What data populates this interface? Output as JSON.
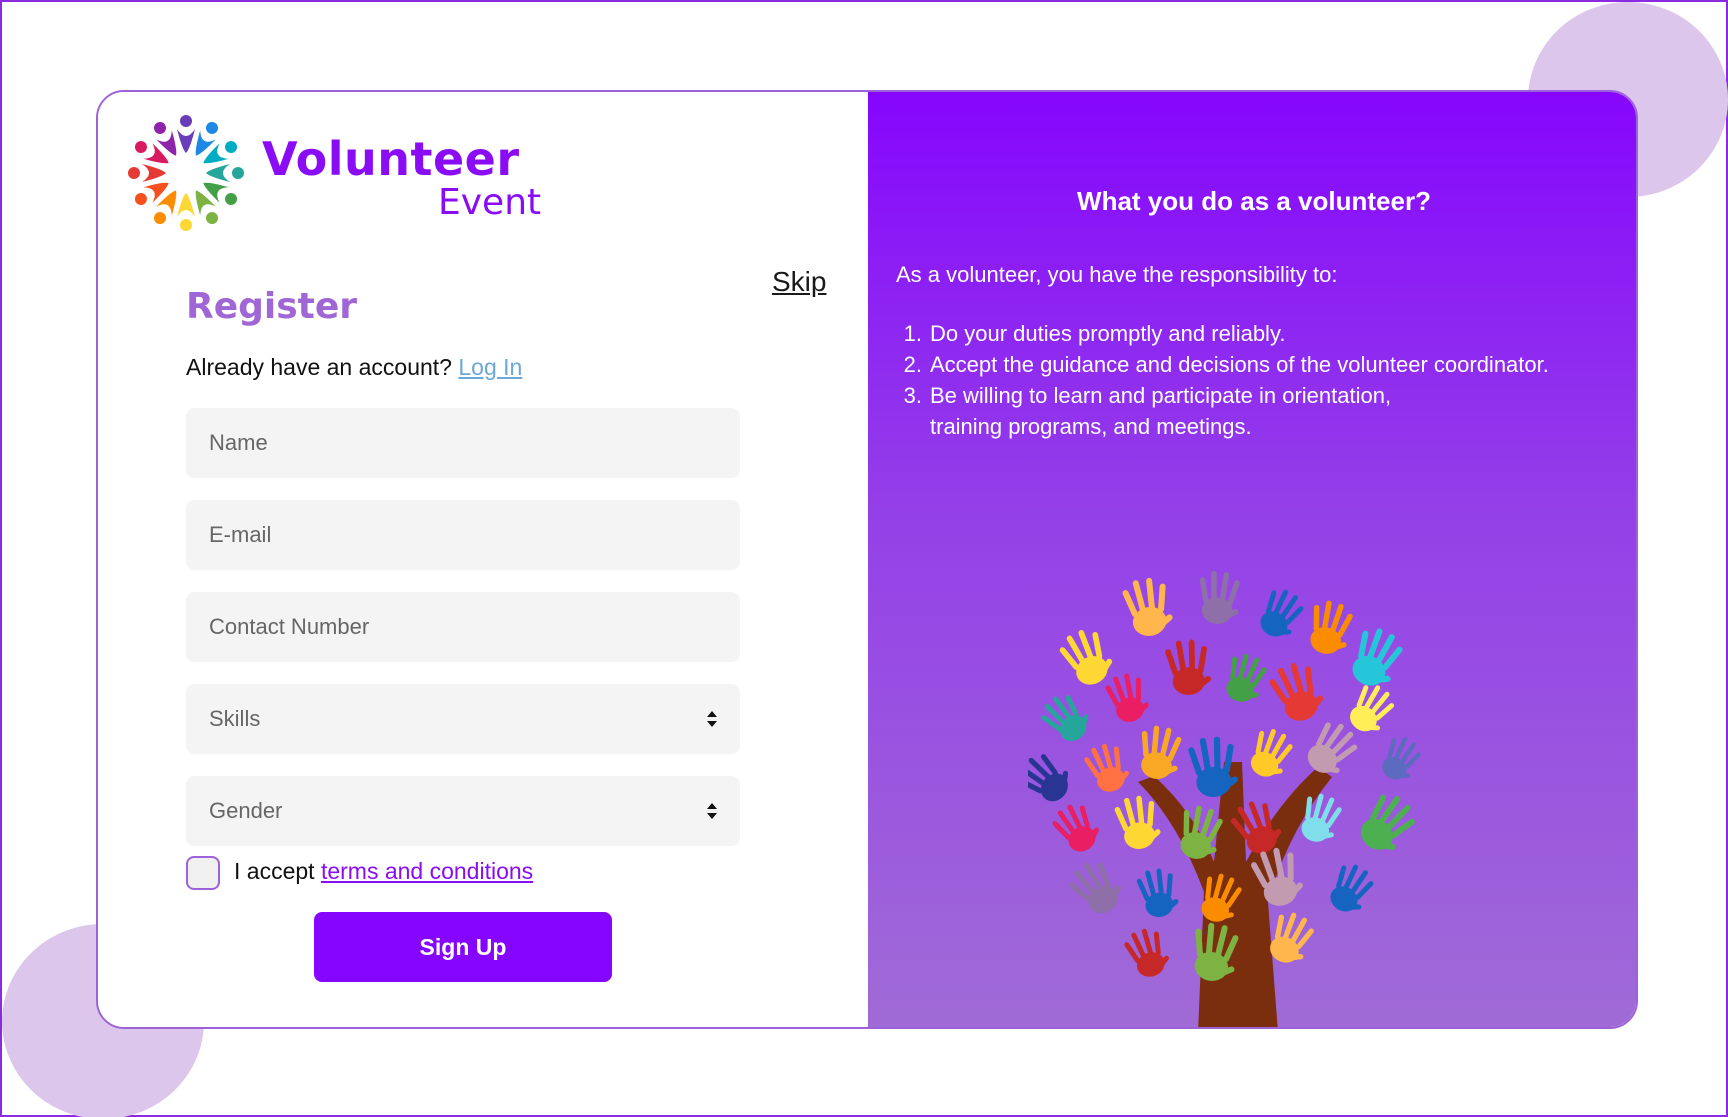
{
  "brand": {
    "title": "Volunteer",
    "subtitle": "Event",
    "accent_color": "#8a0cf5"
  },
  "form": {
    "skip_label": "Skip",
    "heading": "Register",
    "account_prompt": "Already have an account?",
    "login_label": "Log In",
    "fields": {
      "name_placeholder": "Name",
      "email_placeholder": "E-mail",
      "contact_placeholder": "Contact Number",
      "skills_placeholder": "Skills",
      "gender_placeholder": "Gender"
    },
    "accept_prefix": "I accept",
    "terms_label": "terms and conditions",
    "submit_label": "Sign Up",
    "button_color": "#8606fd"
  },
  "info": {
    "title": "What you do as a volunteer?",
    "intro": "As a volunteer, you have the responsibility to:",
    "items": [
      {
        "number": "1.",
        "text": "Do your duties promptly and reliably."
      },
      {
        "number": "2.",
        "text": "Accept the guidance and decisions of the volunteer coordinator."
      },
      {
        "number": "3.",
        "text": "Be willing to learn and participate in orientation, training programs, and meetings."
      }
    ],
    "background_colors": [
      "#8606fd",
      "#a06bd6"
    ]
  }
}
